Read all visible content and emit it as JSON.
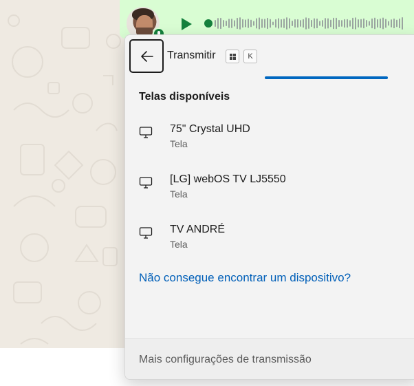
{
  "colors": {
    "wallpaper": "#efeae2",
    "bubble": "#d9fdd3",
    "play": "#15803d",
    "accent": "#0067c0",
    "link": "#005fb8",
    "panel": "#f3f3f3"
  },
  "voice_message": {
    "play_icon": "play-icon",
    "avatar_icon": "avatar",
    "badge_icon": "microphone-icon"
  },
  "cast_panel": {
    "back_icon": "arrow-left-icon",
    "title": "Transmitir",
    "shortcut": {
      "win_icon": "windows-key-icon",
      "key": "K"
    },
    "section_title": "Telas disponíveis",
    "devices": [
      {
        "name": "75\" Crystal UHD",
        "type": "Tela",
        "icon": "monitor-icon"
      },
      {
        "name": "[LG] webOS TV LJ5550",
        "type": "Tela",
        "icon": "monitor-icon"
      },
      {
        "name": "TV ANDRÉ",
        "type": "Tela",
        "icon": "monitor-icon"
      }
    ],
    "help_link": "Não consegue encontrar um dispositivo?",
    "footer_link": "Mais configurações de transmissão"
  }
}
